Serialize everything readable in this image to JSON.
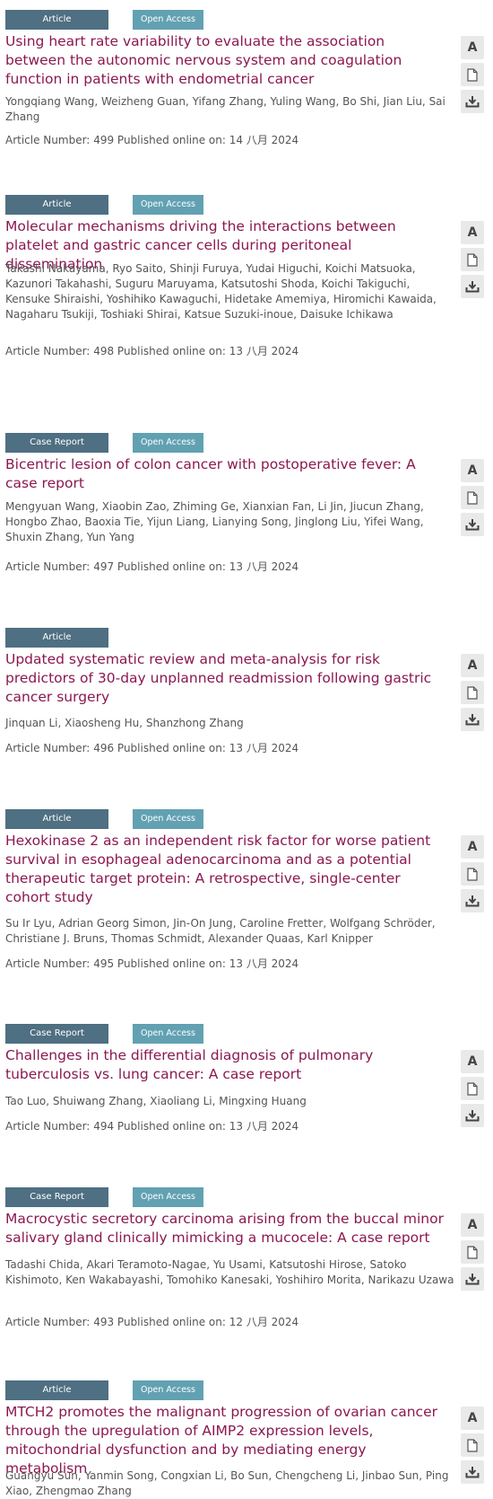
{
  "labels": {
    "article_number_prefix": "Article Number:",
    "published_prefix": "Published online on:",
    "abstract_icon_letter": "A"
  },
  "articles": [
    {
      "type": "Article",
      "access": "Open Access",
      "title": "Using heart rate variability to evaluate the association between the autonomic nervous system and coagulation function in patients with endometrial cancer",
      "authors": "Yongqiang Wang, Weizheng Guan, Yifang Zhang, Yuling Wang, Bo Shi, Jian Liu, Sai Zhang",
      "number": "499",
      "date": "14 八月 2024"
    },
    {
      "type": "Article",
      "access": "Open Access",
      "title": "Molecular mechanisms driving the interactions between platelet and gastric cancer cells during peritoneal dissemination",
      "authors": "Takashi Nakayama, Ryo Saito, Shinji Furuya, Yudai Higuchi, Koichi Matsuoka, Kazunori Takahashi, Suguru Maruyama, Katsutoshi Shoda, Koichi Takiguchi, Kensuke Shiraishi, Yoshihiko Kawaguchi, Hidetake Amemiya, Hiromichi Kawaida, Nagaharu Tsukiji, Toshiaki Shirai, Katsue Suzuki-inoue, Daisuke Ichikawa",
      "number": "498",
      "date": "13 八月 2024"
    },
    {
      "type": "Case Report",
      "access": "Open Access",
      "title": "Bicentric lesion of colon cancer with postoperative fever: A case report",
      "authors": "Mengyuan Wang, Xiaobin Zao, Zhiming Ge, Xianxian Fan, Li Jin, Jiucun Zhang, Hongbo Zhao, Baoxia Tie, Yijun Liang, Lianying Song, Jinglong Liu, Yifei Wang, Shuxin Zhang, Yun Yang",
      "number": "497",
      "date": "13 八月 2024"
    },
    {
      "type": "Article",
      "access": "",
      "title": "Updated systematic review and meta-analysis for risk predictors of 30-day unplanned readmission following gastric cancer surgery",
      "authors": "Jinquan Li, Xiaosheng Hu, Shanzhong Zhang",
      "number": "496",
      "date": "13 八月 2024"
    },
    {
      "type": "Article",
      "access": "Open Access",
      "title": "Hexokinase 2 as an independent risk factor for worse patient survival in esophageal adenocarcinoma and as a potential therapeutic target protein: A retrospective, single-center cohort study",
      "authors": "Su Ir Lyu, Adrian Georg Simon, Jin-On Jung, Caroline Fretter, Wolfgang Schröder, Christiane J. Bruns, Thomas Schmidt, Alexander Quaas, Karl Knipper",
      "number": "495",
      "date": "13 八月 2024"
    },
    {
      "type": "Case Report",
      "access": "Open Access",
      "title": "Challenges in the differential diagnosis of pulmonary tuberculosis vs. lung cancer: A case report",
      "authors": "Tao Luo, Shuiwang Zhang, Xiaoliang Li, Mingxing Huang",
      "number": "494",
      "date": "13 八月 2024"
    },
    {
      "type": "Case Report",
      "access": "Open Access",
      "title": "Macrocystic secretory carcinoma arising from the buccal minor salivary gland clinically mimicking a mucocele: A case report",
      "authors": "Tadashi Chida, Akari Teramoto-Nagae, Yu Usami, Katsutoshi Hirose, Satoko Kishimoto, Ken Wakabayashi, Tomohiko Kanesaki, Yoshihiro Morita, Narikazu Uzawa",
      "number": "493",
      "date": "12 八月 2024"
    },
    {
      "type": "Article",
      "access": "Open Access",
      "title": "MTCH2 promotes the malignant progression of ovarian cancer through the upregulation of AIMP2 expression levels, mitochondrial dysfunction and by mediating energy metabolism",
      "authors": "Guangyu Sun, Yanmin Song, Congxian Li, Bo Sun, Chengcheng Li, Jinbao Sun, Ping Xiao, Zhengmao Zhang",
      "number": "",
      "date": ""
    }
  ]
}
